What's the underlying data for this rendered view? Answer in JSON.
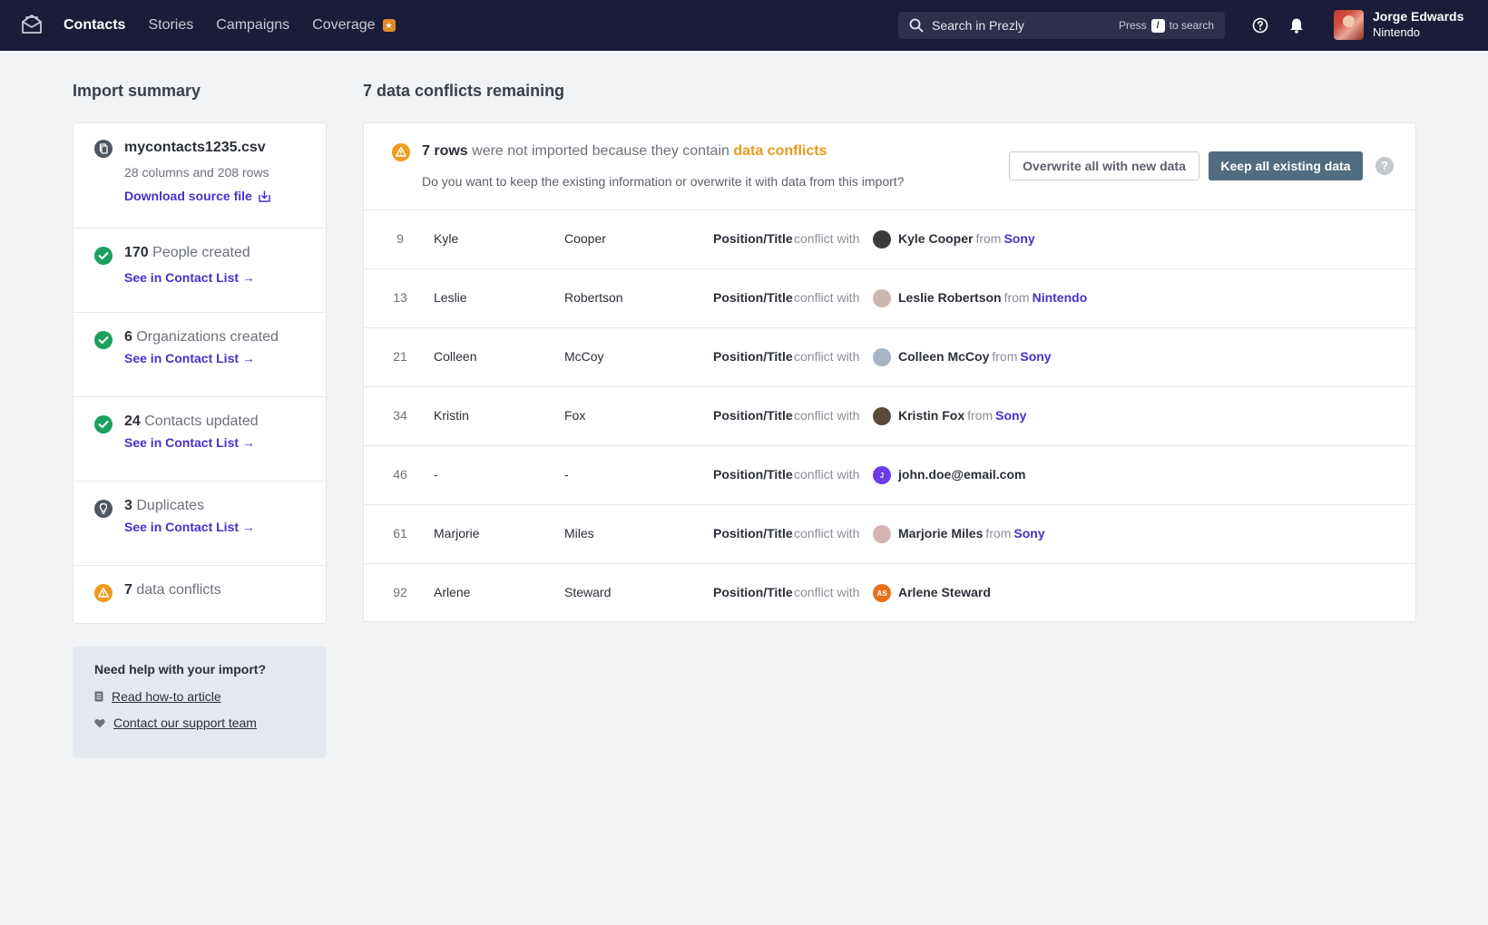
{
  "nav": {
    "items": [
      {
        "label": "Contacts",
        "active": true
      },
      {
        "label": "Stories",
        "active": false
      },
      {
        "label": "Campaigns",
        "active": false
      },
      {
        "label": "Coverage",
        "active": false,
        "badge_icon": "star-icon"
      }
    ]
  },
  "search": {
    "text": "Search in Prezly",
    "hint_prefix": "Press",
    "hint_key": "/",
    "hint_suffix": "to search"
  },
  "user": {
    "name": "Jorge Edwards",
    "org": "Nintendo"
  },
  "summary": {
    "title": "Import summary",
    "file": {
      "name": "mycontacts1235.csv",
      "details": "28 columns and 208 rows",
      "download_label": "Download source file"
    },
    "items": [
      {
        "count": "170",
        "label": "People created",
        "link": "See in Contact List →",
        "icon": "check-circle-icon"
      },
      {
        "count": "6",
        "label": "Organizations created",
        "link": "See in Contact List →",
        "icon": "check-circle-icon"
      },
      {
        "count": "24",
        "label": "Contacts updated",
        "link": "See in Contact List →",
        "icon": "check-circle-icon"
      },
      {
        "count": "3",
        "label": "Duplicates",
        "link": "See in Contact List →",
        "icon": "lightbulb-icon"
      },
      {
        "count": "7",
        "label": "data conflicts",
        "icon": "warning-icon"
      }
    ]
  },
  "help": {
    "title": "Need help with your import?",
    "article_link": "Read how-to article",
    "support_link": "Contact our support team"
  },
  "conflicts": {
    "title": "7 data conflicts remaining",
    "banner_count": "7 rows",
    "banner_mid": "were not imported because they contain",
    "banner_highlight": "data conflicts",
    "banner_question": "Do you want to keep the existing information or overwrite it with data from this import?",
    "overwrite_label": "Overwrite all with new data",
    "keep_label": "Keep all existing data",
    "help_glyph": "?",
    "conflict_with_text": "conflict with",
    "from_text": "from",
    "rows": [
      {
        "num": "9",
        "first": "Kyle",
        "last": "Cooper",
        "field": "Position/Title",
        "contact": "Kyle Cooper",
        "org": "Sony",
        "avatar_color": "#3b3b3b",
        "avatar_initials": ""
      },
      {
        "num": "13",
        "first": "Leslie",
        "last": "Robertson",
        "field": "Position/Title",
        "contact": "Leslie Robertson",
        "org": "Nintendo",
        "avatar_color": "#c9b8b0",
        "avatar_initials": ""
      },
      {
        "num": "21",
        "first": "Colleen",
        "last": "McCoy",
        "field": "Position/Title",
        "contact": "Colleen McCoy",
        "org": "Sony",
        "avatar_color": "#a7b4c2",
        "avatar_initials": ""
      },
      {
        "num": "34",
        "first": "Kristin",
        "last": "Fox",
        "field": "Position/Title",
        "contact": "Kristin Fox",
        "org": "Sony",
        "avatar_color": "#5a4a3a",
        "avatar_initials": ""
      },
      {
        "num": "46",
        "first": "-",
        "last": "-",
        "field": "Position/Title",
        "contact": "john.doe@email.com",
        "org": "",
        "avatar_color": "#6a3de8",
        "avatar_initials": "J"
      },
      {
        "num": "61",
        "first": "Marjorie",
        "last": "Miles",
        "field": "Position/Title",
        "contact": "Marjorie Miles",
        "org": "Sony",
        "avatar_color": "#d9b3b3",
        "avatar_initials": ""
      },
      {
        "num": "92",
        "first": "Arlene",
        "last": "Steward",
        "field": "Position/Title",
        "contact": "Arlene Steward",
        "org": "",
        "avatar_color": "#e8711d",
        "avatar_initials": "AS"
      }
    ]
  }
}
